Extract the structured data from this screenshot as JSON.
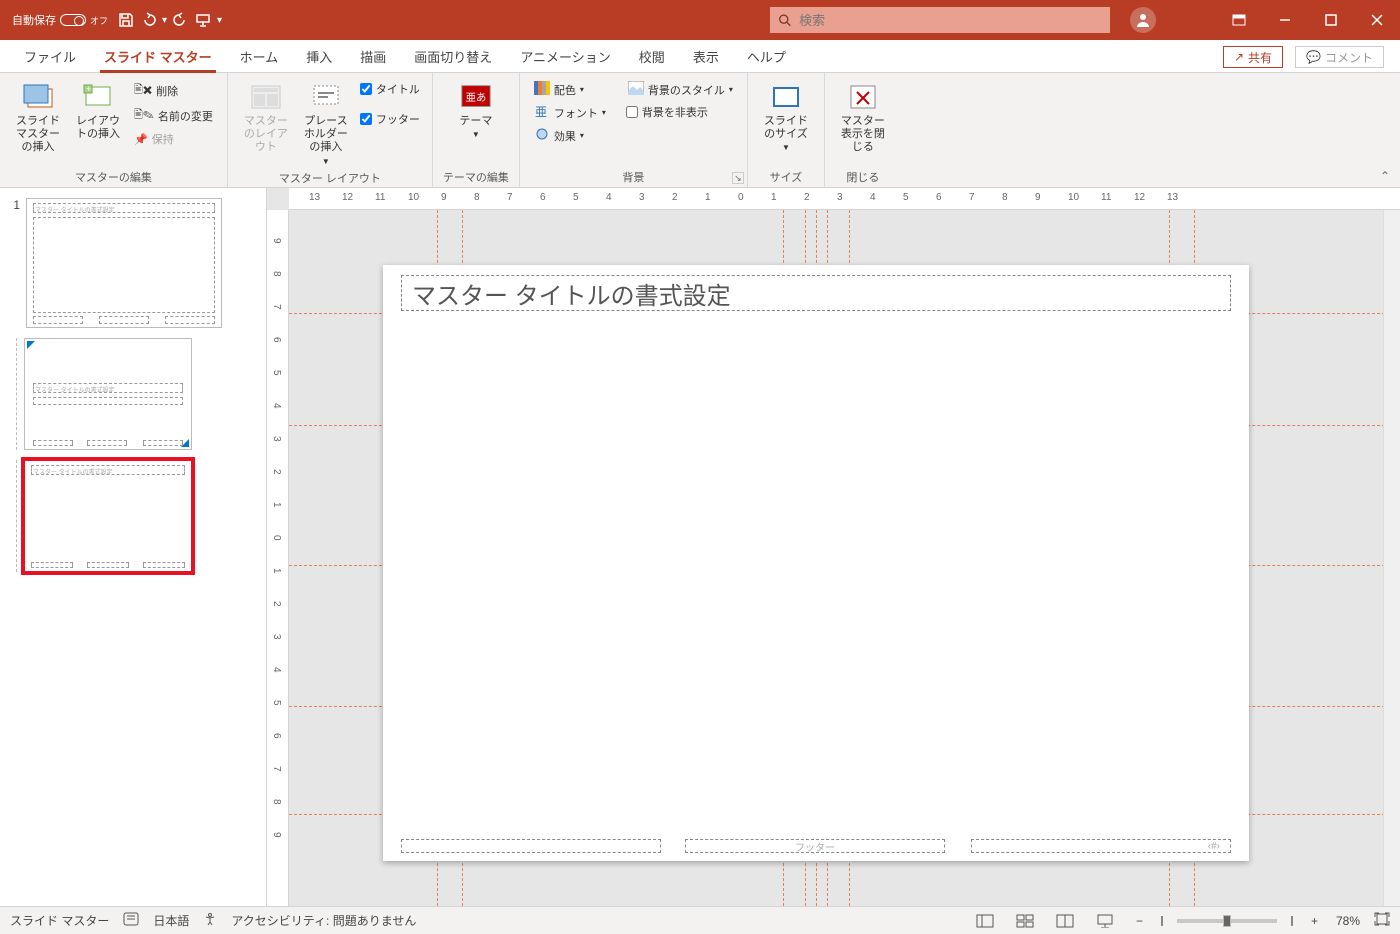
{
  "titlebar": {
    "autosave": "自動保存",
    "autosave_state": "オフ",
    "search_placeholder": "検索"
  },
  "tabs": {
    "file": "ファイル",
    "slide_master": "スライド マスター",
    "home": "ホーム",
    "insert": "挿入",
    "draw": "描画",
    "transitions": "画面切り替え",
    "animations": "アニメーション",
    "review": "校閲",
    "view": "表示",
    "help": "ヘルプ",
    "share": "共有",
    "comment": "コメント"
  },
  "ribbon": {
    "insert_slide_master": "スライド マスターの挿入",
    "insert_layout": "レイアウトの挿入",
    "delete": "削除",
    "rename": "名前の変更",
    "preserve": "保持",
    "g_master_edit": "マスターの編集",
    "master_layout": "マスターのレイアウト",
    "insert_placeholder": "プレースホルダーの挿入",
    "title": "タイトル",
    "footer": "フッター",
    "g_master_layout": "マスター レイアウト",
    "themes": "テーマ",
    "g_theme_edit": "テーマの編集",
    "colors": "配色",
    "fonts": "フォント",
    "effects": "効果",
    "bg_styles": "背景のスタイル",
    "hide_bg": "背景を非表示",
    "g_background": "背景",
    "slide_size": "スライドのサイズ",
    "g_size": "サイズ",
    "close_master": "マスター表示を閉じる",
    "g_close": "閉じる"
  },
  "thumbs": {
    "master_num": "1",
    "master_title": "マスター タイトルの書式設定",
    "layout_title": "マスター タイトルの書式設定"
  },
  "slide": {
    "title": "マスター タイトルの書式設定",
    "footer": "フッター",
    "pagenum": "‹#›"
  },
  "status": {
    "mode": "スライド マスター",
    "lang": "日本語",
    "a11y": "アクセシビリティ: 問題ありません",
    "zoom": "78%"
  },
  "ruler_h": [
    "13",
    "12",
    "11",
    "10",
    "9",
    "8",
    "7",
    "6",
    "5",
    "4",
    "3",
    "2",
    "1",
    "0",
    "1",
    "2",
    "3",
    "4",
    "5",
    "6",
    "7",
    "8",
    "9",
    "10",
    "11",
    "12",
    "13"
  ],
  "ruler_v": [
    "9",
    "8",
    "7",
    "6",
    "5",
    "4",
    "3",
    "2",
    "1",
    "0",
    "1",
    "2",
    "3",
    "4",
    "5",
    "6",
    "7",
    "8",
    "9"
  ]
}
